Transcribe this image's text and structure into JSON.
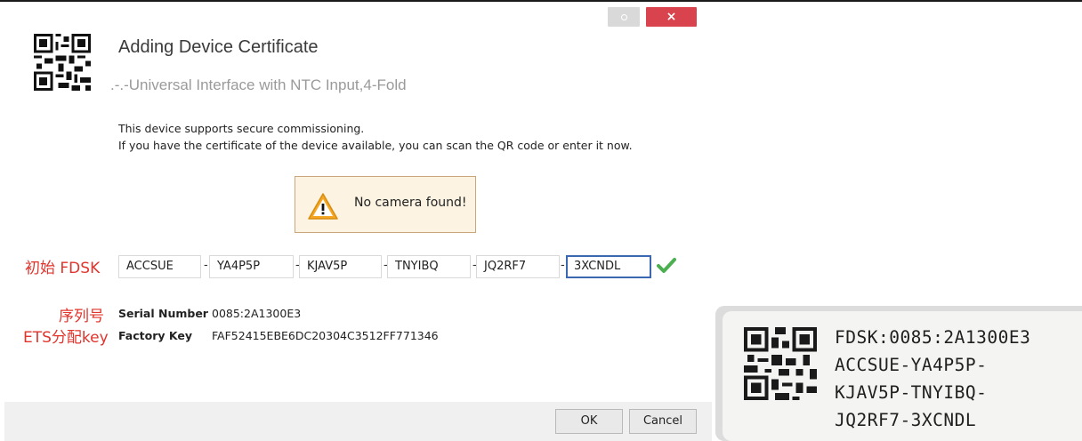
{
  "dialog": {
    "title": "Adding Device Certificate",
    "subtitle": ".-.-Universal Interface with NTC Input,4-Fold",
    "description_line1": "This device supports secure commissioning.",
    "description_line2": "If you have the certificate of the device available, you can scan the QR code or enter it now.",
    "warning": "No camera found!",
    "close_symbol": "×",
    "fdsk_segments": [
      "ACCSUE",
      "YA4P5P",
      "KJAV5P",
      "TNYIBQ",
      "JQ2RF7",
      "3XCNDL"
    ],
    "separator": "-",
    "serial_label": "Serial Number",
    "serial_value": "0085:2A1300E3",
    "factory_key_label": "Factory Key",
    "factory_key_value": "FAF52415EBE6DC20304C3512FF771346",
    "ok_label": "OK",
    "cancel_label": "Cancel"
  },
  "annotations": {
    "fdsk": "初始 FDSK",
    "serial": "序列号",
    "ets_key": "ETS分配key"
  },
  "device_label": {
    "line1": "FDSK:0085:2A1300E3",
    "line2": "ACCSUE-YA4P5P-",
    "line3": "KJAV5P-TNYIBQ-",
    "line4": "JQ2RF7-3XCNDL"
  },
  "colors": {
    "close_button": "#d8434d",
    "annotation_red": "#e0342d",
    "active_border": "#3b68b0",
    "check_green": "#4caf50",
    "warning_bg": "#fcf3e2"
  },
  "icons": [
    "qr-code-icon",
    "warning-icon",
    "check-icon",
    "close-icon",
    "restore-icon"
  ]
}
